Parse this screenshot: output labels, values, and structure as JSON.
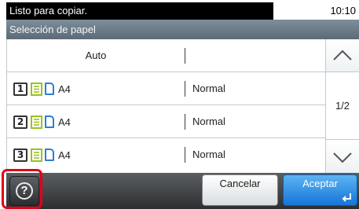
{
  "status_bar": {
    "message": "Listo para copiar.",
    "time": "10:10"
  },
  "screen_title": "Selección de papel",
  "rows": [
    {
      "label": "Auto",
      "media": ""
    },
    {
      "tray": "1",
      "size": "A4",
      "media": "Normal"
    },
    {
      "tray": "2",
      "size": "A4",
      "media": "Normal"
    },
    {
      "tray": "3",
      "size": "A4",
      "media": "Normal"
    }
  ],
  "page_indicator": "1/2",
  "buttons": {
    "cancel": "Cancelar",
    "accept": "Aceptar"
  },
  "colors": {
    "accept": "#1675d8",
    "highlight": "#e2001a",
    "paper_icon": "#9ac21f",
    "media_icon": "#2b7fd6"
  },
  "icons": [
    "scroll-up-icon",
    "scroll-down-icon",
    "help-icon",
    "enter-icon",
    "tray-number-icon",
    "paper-icon",
    "media-icon"
  ]
}
